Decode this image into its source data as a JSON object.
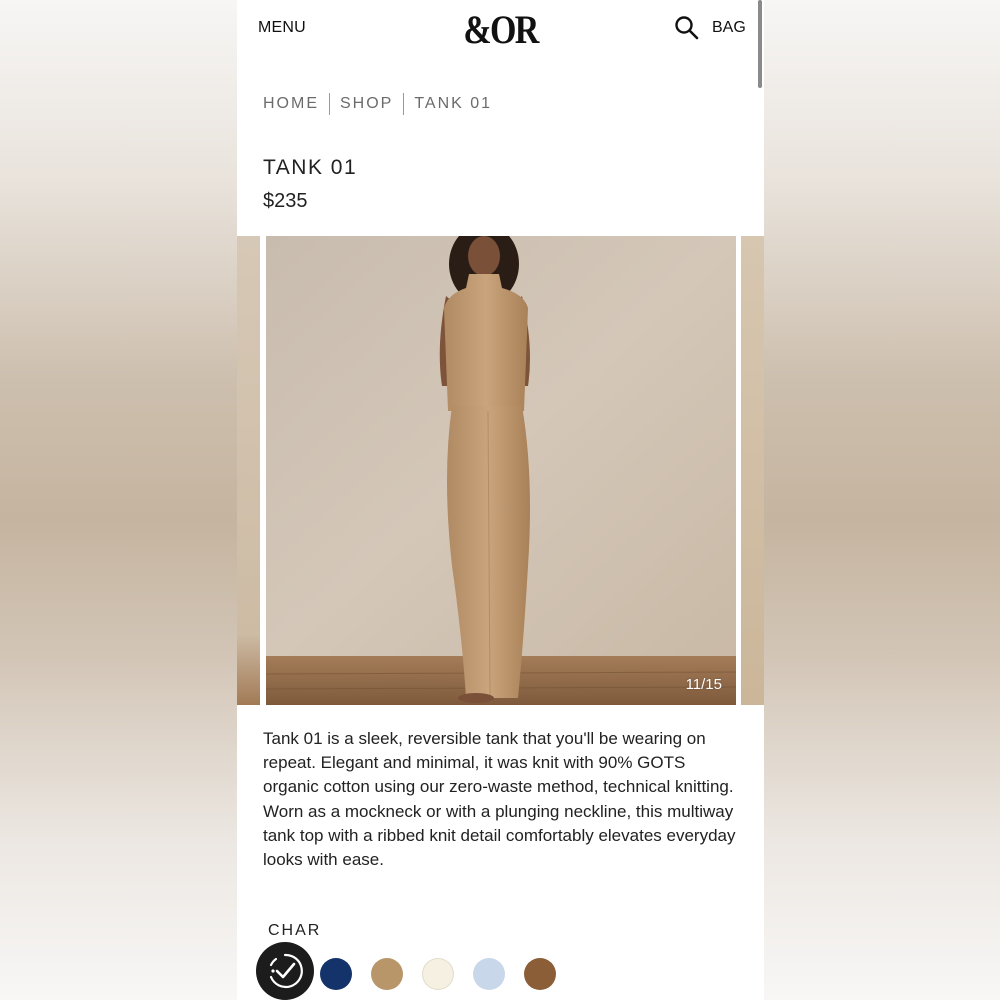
{
  "header": {
    "menu_label": "MENU",
    "logo_text": "&OR",
    "bag_label": "BAG",
    "search_icon": "search-icon"
  },
  "breadcrumb": [
    "HOME",
    "SHOP",
    "TANK 01"
  ],
  "product": {
    "title": "TANK 01",
    "price": "$235",
    "gallery_counter": "11/15",
    "description": "Tank 01 is a sleek, reversible tank that you'll be wearing on repeat. Elegant and minimal, it was knit with 90% GOTS organic cotton using our zero-waste method, technical knitting. Worn as a mockneck or with a plunging neckline, this multiway tank top with a ribbed knit detail comfortably elevates everyday looks with ease."
  },
  "colors": {
    "label": "CHAR",
    "selected_swatch": "#1c1c1c",
    "swatches": [
      "#14336b",
      "#b8966a",
      "#f5f0e2",
      "#c9d7ea",
      "#8c5e38"
    ]
  }
}
